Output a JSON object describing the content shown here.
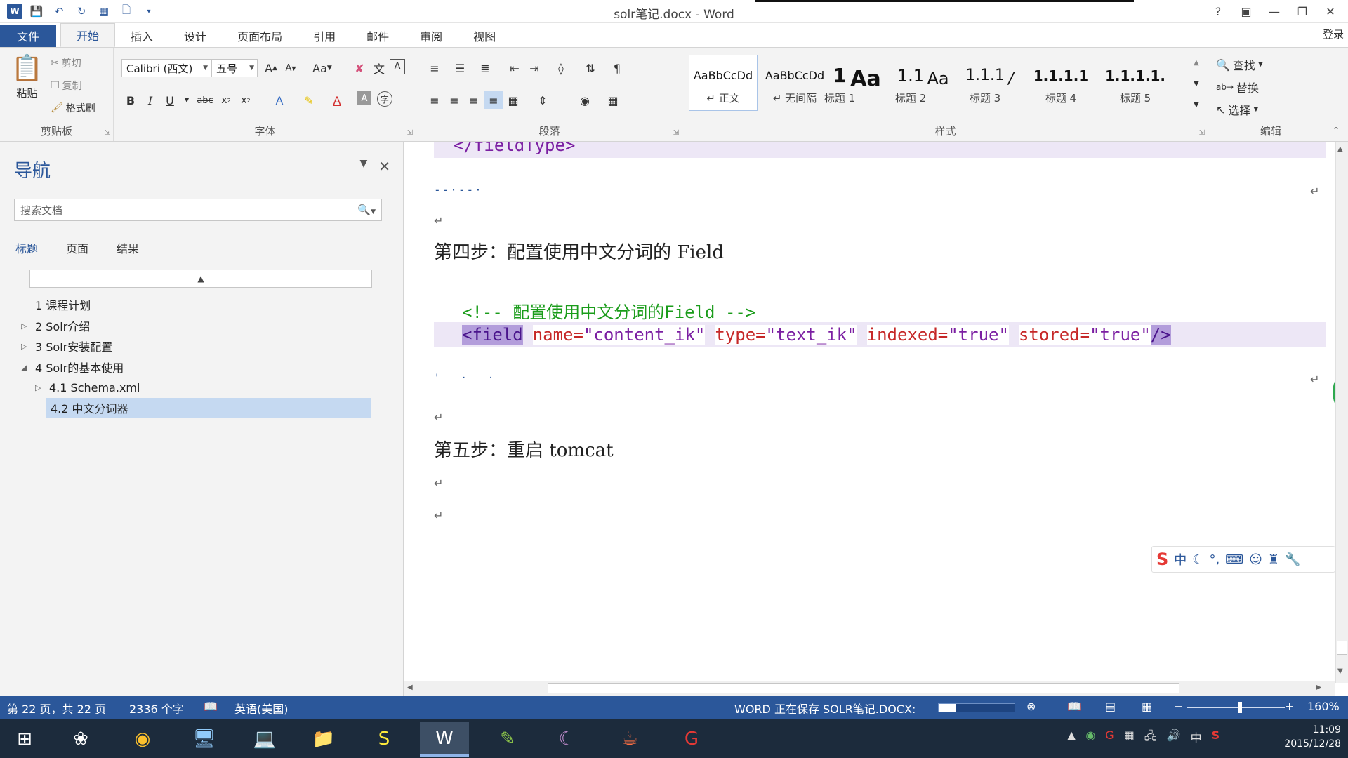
{
  "window": {
    "title": "solr笔记.docx - Word",
    "help": "?",
    "login": "登录"
  },
  "tabs": [
    {
      "label": "文件"
    },
    {
      "label": "开始"
    },
    {
      "label": "插入"
    },
    {
      "label": "设计"
    },
    {
      "label": "页面布局"
    },
    {
      "label": "引用"
    },
    {
      "label": "邮件"
    },
    {
      "label": "审阅"
    },
    {
      "label": "视图"
    }
  ],
  "ribbon": {
    "clipboard": {
      "label": "剪贴板",
      "paste": "粘贴",
      "cut": "剪切",
      "copy": "复制",
      "format_painter": "格式刷"
    },
    "font": {
      "label": "字体",
      "family": "Calibri (西文)",
      "size": "五号",
      "aa": "Aa"
    },
    "paragraph": {
      "label": "段落"
    },
    "styles": {
      "label": "样式",
      "items": [
        {
          "preview": "AaBbCcDd",
          "name": "↵ 正文"
        },
        {
          "preview": "AaBbCcDd",
          "name": "↵ 无间隔"
        },
        {
          "preview": "1",
          "name": "标题 1"
        },
        {
          "preview": "Aa",
          "name": "标题 2"
        },
        {
          "preview": "1.1",
          "name": "标题 3"
        },
        {
          "preview": "Aa",
          "name": "标题 4"
        },
        {
          "preview": "1.1.1",
          "name": "标题 5"
        }
      ],
      "display_names": [
        "↵ 正文",
        "↵ 无间隔",
        "标题 1",
        "标题 2",
        "标题 3",
        "标题 4",
        "标题 5"
      ],
      "display_previews": [
        "AaBbCcDd",
        "AaBbCcDd",
        "1",
        "Aa",
        "1.1",
        "Aa",
        "1.1.1",
        "/",
        "1.1.1.1",
        "1.1.1.1."
      ]
    },
    "editing": {
      "label": "编辑",
      "find": "查找",
      "replace": "替换",
      "select": "选择"
    }
  },
  "nav": {
    "title": "导航",
    "search_placeholder": "搜索文档",
    "tabs": [
      "标题",
      "页面",
      "结果"
    ],
    "items": [
      {
        "label": "1 课程计划",
        "level": 1,
        "expand": ""
      },
      {
        "label": "2 Solr介绍",
        "level": 1,
        "expand": "▷"
      },
      {
        "label": "3 Solr安装配置",
        "level": 1,
        "expand": "▷"
      },
      {
        "label": "4 Solr的基本使用",
        "level": 1,
        "expand": "◢"
      },
      {
        "label": "4.1 Schema.xml",
        "level": 2,
        "expand": "▷"
      },
      {
        "label": "4.2 中文分词器",
        "level": 2,
        "expand": "",
        "selected": true
      }
    ]
  },
  "document": {
    "closing_tag": "</fieldType>",
    "step4": "第四步：配置使用中文分词的 Field",
    "comment": "<!-- 配置使用中文分词的Field -->",
    "field_open": "<field",
    "attr_name": "name=",
    "val_name": "\"content_ik\"",
    "attr_type": "type=",
    "val_type": "\"text_ik\"",
    "attr_indexed": "indexed=",
    "val_indexed": "\"true\"",
    "attr_stored": "stored=",
    "val_stored": "\"true\"",
    "field_close": "/>",
    "step5": "第五步：重启 tomcat",
    "paragraph_mark": "↵"
  },
  "status": {
    "page": "第 22 页，共 22 页",
    "words": "2336 个字",
    "language": "英语(美国)",
    "saving": "WORD 正在保存 SOLR笔记.DOCX:",
    "zoom": "160%"
  },
  "taskbar": {
    "time": "11:09",
    "date": "2015/12/28",
    "ime_lang": "中"
  },
  "colors": {
    "accent": "#2b579a",
    "code_green": "#1a9c1a",
    "code_red": "#c62828",
    "code_purple": "#7b1fa2",
    "highlight": "#ede7f6"
  }
}
